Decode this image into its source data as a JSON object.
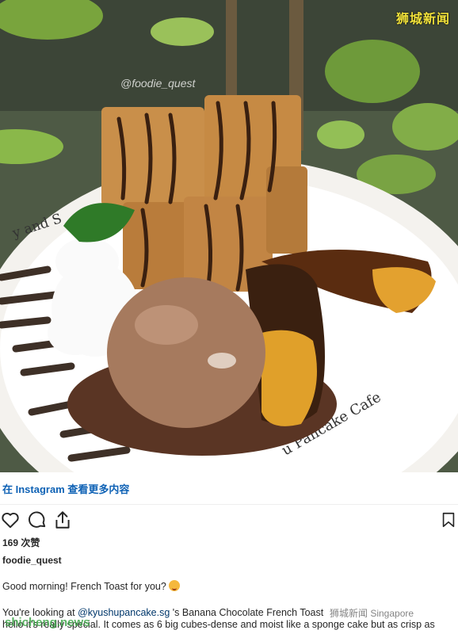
{
  "photo": {
    "top_watermark": "狮城新闻",
    "handle_overlay": "@foodie_quest",
    "plate_text_left": "y and S",
    "plate_text_right": "u Pancake Cafe"
  },
  "view_more": {
    "label": "在 Instagram 查看更多内容"
  },
  "actions": {
    "like": "heart-icon",
    "comment": "comment-icon",
    "share": "share-icon",
    "save": "bookmark-icon"
  },
  "likes": {
    "text": "169 次赞"
  },
  "post": {
    "username": "foodie_quest",
    "caption_line1": "Good morning! French Toast for you?",
    "caption_prefix": "You're looking at ",
    "mention": "@kyushupancake.sg",
    "caption_rest": " 's Banana Chocolate French Toast",
    "caption_line3": "hello it's really special. It comes as 6 big cubes-dense and moist like a sponge cake but as crisp as"
  },
  "footer": {
    "site_watermark": "shicheng.news",
    "wechat_watermark": "狮城新闻 Singapore"
  },
  "colors": {
    "link_blue": "#0f62b5",
    "mention_blue": "#00376b",
    "text": "#262626"
  }
}
